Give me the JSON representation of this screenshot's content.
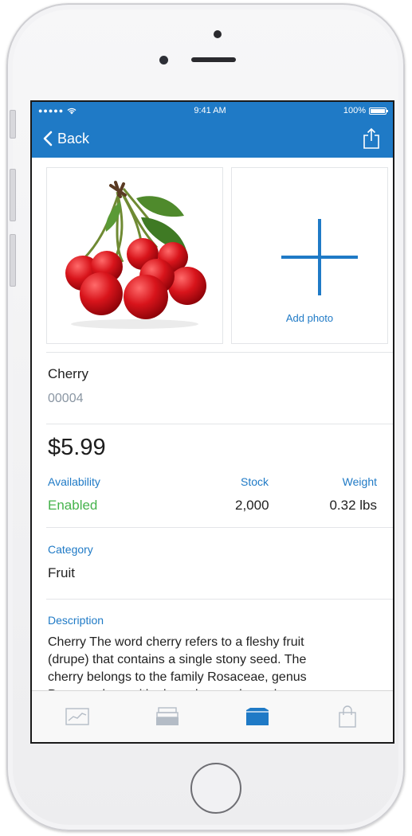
{
  "status_bar": {
    "time": "9:41 AM",
    "battery_percent": "100%",
    "battery_level": 1.0
  },
  "nav": {
    "back_label": "Back",
    "back_icon": "chevron-left-icon",
    "share_icon": "share-icon"
  },
  "photos": {
    "add_label": "Add photo",
    "add_icon": "plus-icon"
  },
  "product": {
    "name": "Cherry",
    "sku": "00004",
    "price": "$5.99",
    "availability_label": "Availability",
    "availability_value": "Enabled",
    "stock_label": "Stock",
    "stock_value": "2,000",
    "weight_label": "Weight",
    "weight_value": "0.32 lbs",
    "category_label": "Category",
    "category_value": "Fruit",
    "description_label": "Description",
    "description_value": "Cherry The word cherry refers to a fleshy fruit (drupe) that contains a single stony seed. The cherry belongs to the family Rosaceae, genus Prunus, along with almonds, peaches, plums,"
  },
  "colors": {
    "accent": "#1f7ac6",
    "enabled": "#45b34c",
    "secondary_text": "#8a96a3"
  },
  "tab_bar": {
    "tabs": [
      {
        "icon": "chart-icon",
        "selected": false
      },
      {
        "icon": "inbox-tray-icon",
        "selected": false
      },
      {
        "icon": "box-icon",
        "selected": true
      },
      {
        "icon": "shopping-bag-icon",
        "selected": false
      }
    ]
  }
}
